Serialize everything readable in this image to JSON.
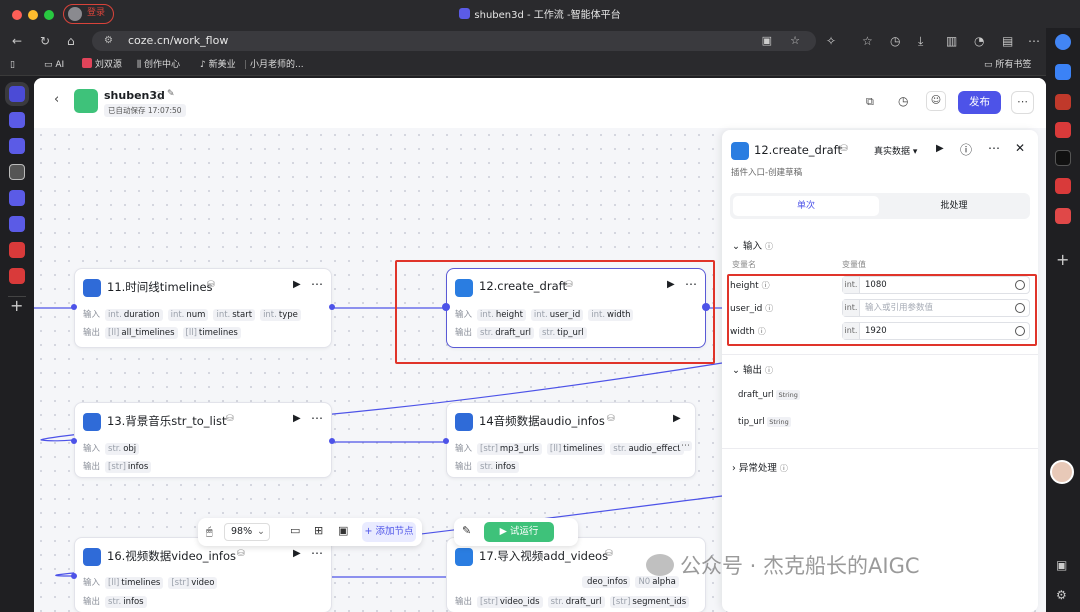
{
  "browser": {
    "login_label": "登录",
    "window_title": "shuben3d - 工作流 -智能体平台",
    "url": "coze.cn/work_flow",
    "bookmarks": [
      "AI",
      "刘双源",
      "创作中心",
      "新美业",
      "小月老师的...",
      "所有书签"
    ]
  },
  "app": {
    "name": "shuben3d",
    "autosave": "已自动保存 17:07:50",
    "publish_label": "发布"
  },
  "nodes": [
    {
      "title": "11.时间线timelines",
      "in_label": "输入",
      "inputs": [
        [
          "int.",
          "duration"
        ],
        [
          "int.",
          "num"
        ],
        [
          "int.",
          "start"
        ],
        [
          "int.",
          "type"
        ]
      ],
      "out_label": "输出",
      "outputs": [
        [
          "[ll]",
          "all_timelines"
        ],
        [
          "[ll]",
          "timelines"
        ]
      ]
    },
    {
      "title": "12.create_draft",
      "in_label": "输入",
      "inputs": [
        [
          "int.",
          "height"
        ],
        [
          "int.",
          "user_id"
        ],
        [
          "int.",
          "width"
        ]
      ],
      "out_label": "输出",
      "outputs": [
        [
          "str.",
          "draft_url"
        ],
        [
          "str.",
          "tip_url"
        ]
      ]
    },
    {
      "title": "13.背景音乐str_to_list",
      "in_label": "输入",
      "inputs": [
        [
          "str.",
          "obj"
        ]
      ],
      "out_label": "输出",
      "outputs": [
        [
          "[str]",
          "infos"
        ]
      ]
    },
    {
      "title": "14音频数据audio_infos",
      "in_label": "输入",
      "inputs": [
        [
          "[str]",
          "mp3_urls"
        ],
        [
          "[ll]",
          "timelines"
        ],
        [
          "str.",
          "audio_effect"
        ]
      ],
      "out_label": "输出",
      "outputs": [
        [
          "str.",
          "infos"
        ]
      ]
    },
    {
      "title": "16.视频数据video_infos",
      "in_label": "输入",
      "inputs": [
        [
          "[ll]",
          "timelines"
        ],
        [
          "[str]",
          "video"
        ]
      ],
      "out_label": "输出",
      "outputs": [
        [
          "str.",
          "infos"
        ]
      ]
    },
    {
      "title": "17.导入视频add_videos",
      "in_label": "输入",
      "inputs": [
        [
          "",
          "deo_infos"
        ],
        [
          "N0",
          "alpha"
        ]
      ],
      "out_label": "输出",
      "outputs": [
        [
          "[str]",
          "video_ids"
        ],
        [
          "str.",
          "draft_url"
        ],
        [
          "[str]",
          "segment_ids"
        ]
      ]
    }
  ],
  "panel": {
    "title": "12.create_draft",
    "mode": "真实数据",
    "subtitle": "插件入口-创建草稿",
    "tab_single": "单次",
    "tab_batch": "批处理",
    "input_section": "输入",
    "col_name": "变量名",
    "col_value": "变量值",
    "params": [
      {
        "name": "height",
        "type": "int.",
        "value": "1080",
        "placeholder": ""
      },
      {
        "name": "user_id",
        "type": "int.",
        "value": "",
        "placeholder": "输入或引用参数值"
      },
      {
        "name": "width",
        "type": "int.",
        "value": "1920",
        "placeholder": ""
      }
    ],
    "output_section": "输出",
    "outputs": [
      {
        "name": "draft_url",
        "type": "String"
      },
      {
        "name": "tip_url",
        "type": "String"
      }
    ],
    "error_section": "异常处理"
  },
  "toolbar": {
    "zoom": "98%",
    "add_node": "添加节点",
    "run": "试运行"
  },
  "watermark": "公众号 · 杰克船长的AIGC"
}
